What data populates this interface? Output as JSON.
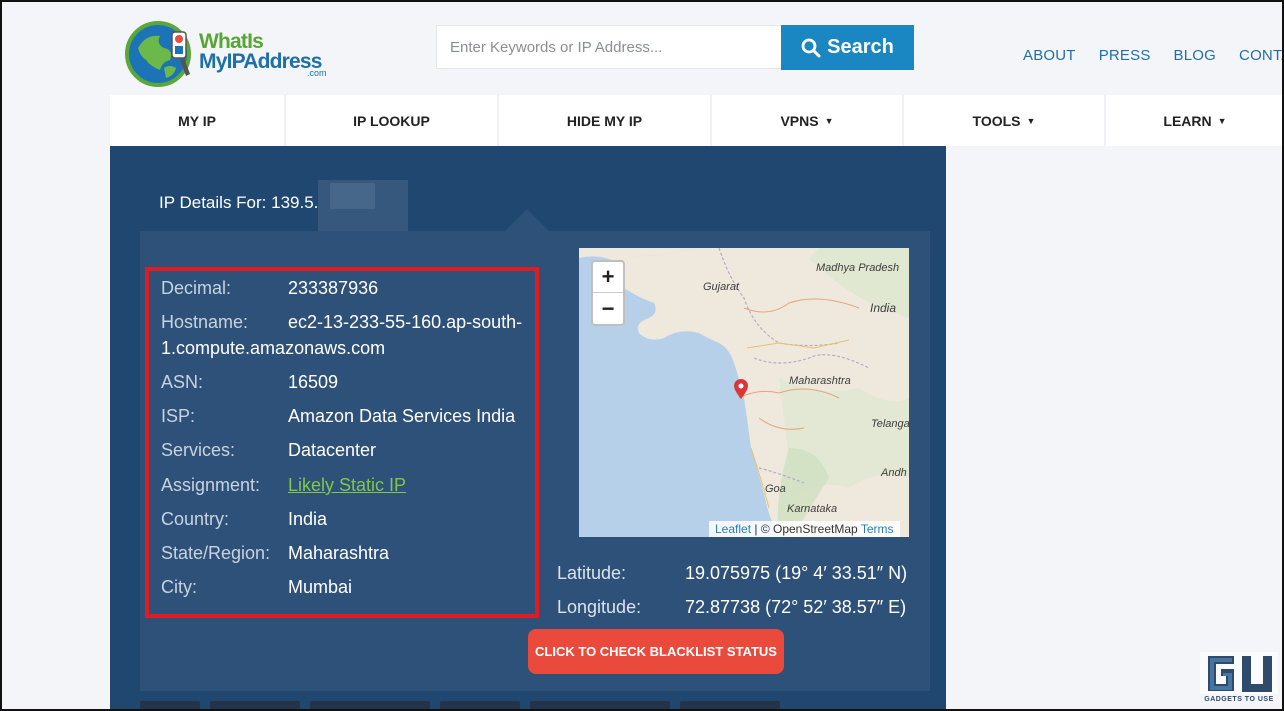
{
  "logo": {
    "line1": "WhatIs",
    "line2": "MyIPAddress",
    "suffix": ".com"
  },
  "search": {
    "placeholder": "Enter Keywords or IP Address...",
    "button_label": "Search"
  },
  "top_links": [
    "ABOUT",
    "PRESS",
    "BLOG",
    "CONTACT"
  ],
  "nav": [
    {
      "label": "MY IP",
      "dropdown": false
    },
    {
      "label": "IP LOOKUP",
      "dropdown": false
    },
    {
      "label": "HIDE MY IP",
      "dropdown": false
    },
    {
      "label": "VPNS",
      "dropdown": true
    },
    {
      "label": "TOOLS",
      "dropdown": true
    },
    {
      "label": "LEARN",
      "dropdown": true
    }
  ],
  "caret": "▼",
  "ip_details_label": "IP Details For: 139.5.",
  "details": [
    {
      "key": "Decimal:",
      "value": "233387936"
    },
    {
      "key": "Hostname:",
      "value": "ec2-13-233-55-160.ap-south-",
      "value2": "1.compute.amazonaws.com"
    },
    {
      "key": "ASN:",
      "value": "16509"
    },
    {
      "key": "ISP:",
      "value": "Amazon Data Services India"
    },
    {
      "key": "Services:",
      "value": "Datacenter"
    },
    {
      "key": "Assignment:",
      "value": "Likely Static IP",
      "link": true
    },
    {
      "key": "Country:",
      "value": "India"
    },
    {
      "key": "State/Region:",
      "value": "Maharashtra"
    },
    {
      "key": "City:",
      "value": "Mumbai"
    }
  ],
  "map": {
    "zoom_in": "+",
    "zoom_out": "−",
    "labels": [
      "Madhya Pradesh",
      "Gujarat",
      "India",
      "Maharashtra",
      "Telanga",
      "Andh",
      "Goa",
      "Karnataka"
    ],
    "attribution": {
      "leaflet": "Leaflet",
      "osm": " | © OpenStreetMap ",
      "terms": "Terms"
    }
  },
  "coords": [
    {
      "label": "Latitude:",
      "value": "19.075975  (19° 4′ 33.51″ N)"
    },
    {
      "label": "Longitude:",
      "value": "72.87738  (72° 52′ 38.57″ E)"
    }
  ],
  "blacklist_button": "CLICK TO CHECK BLACKLIST STATUS",
  "watermark": "GADGETS TO USE",
  "colors": {
    "panel": "#1f4770",
    "inner": "#2e5179",
    "accent": "#1a87c3",
    "highlight_border": "#e01b22",
    "button": "#ea4a3b",
    "link": "#7fc84a"
  }
}
